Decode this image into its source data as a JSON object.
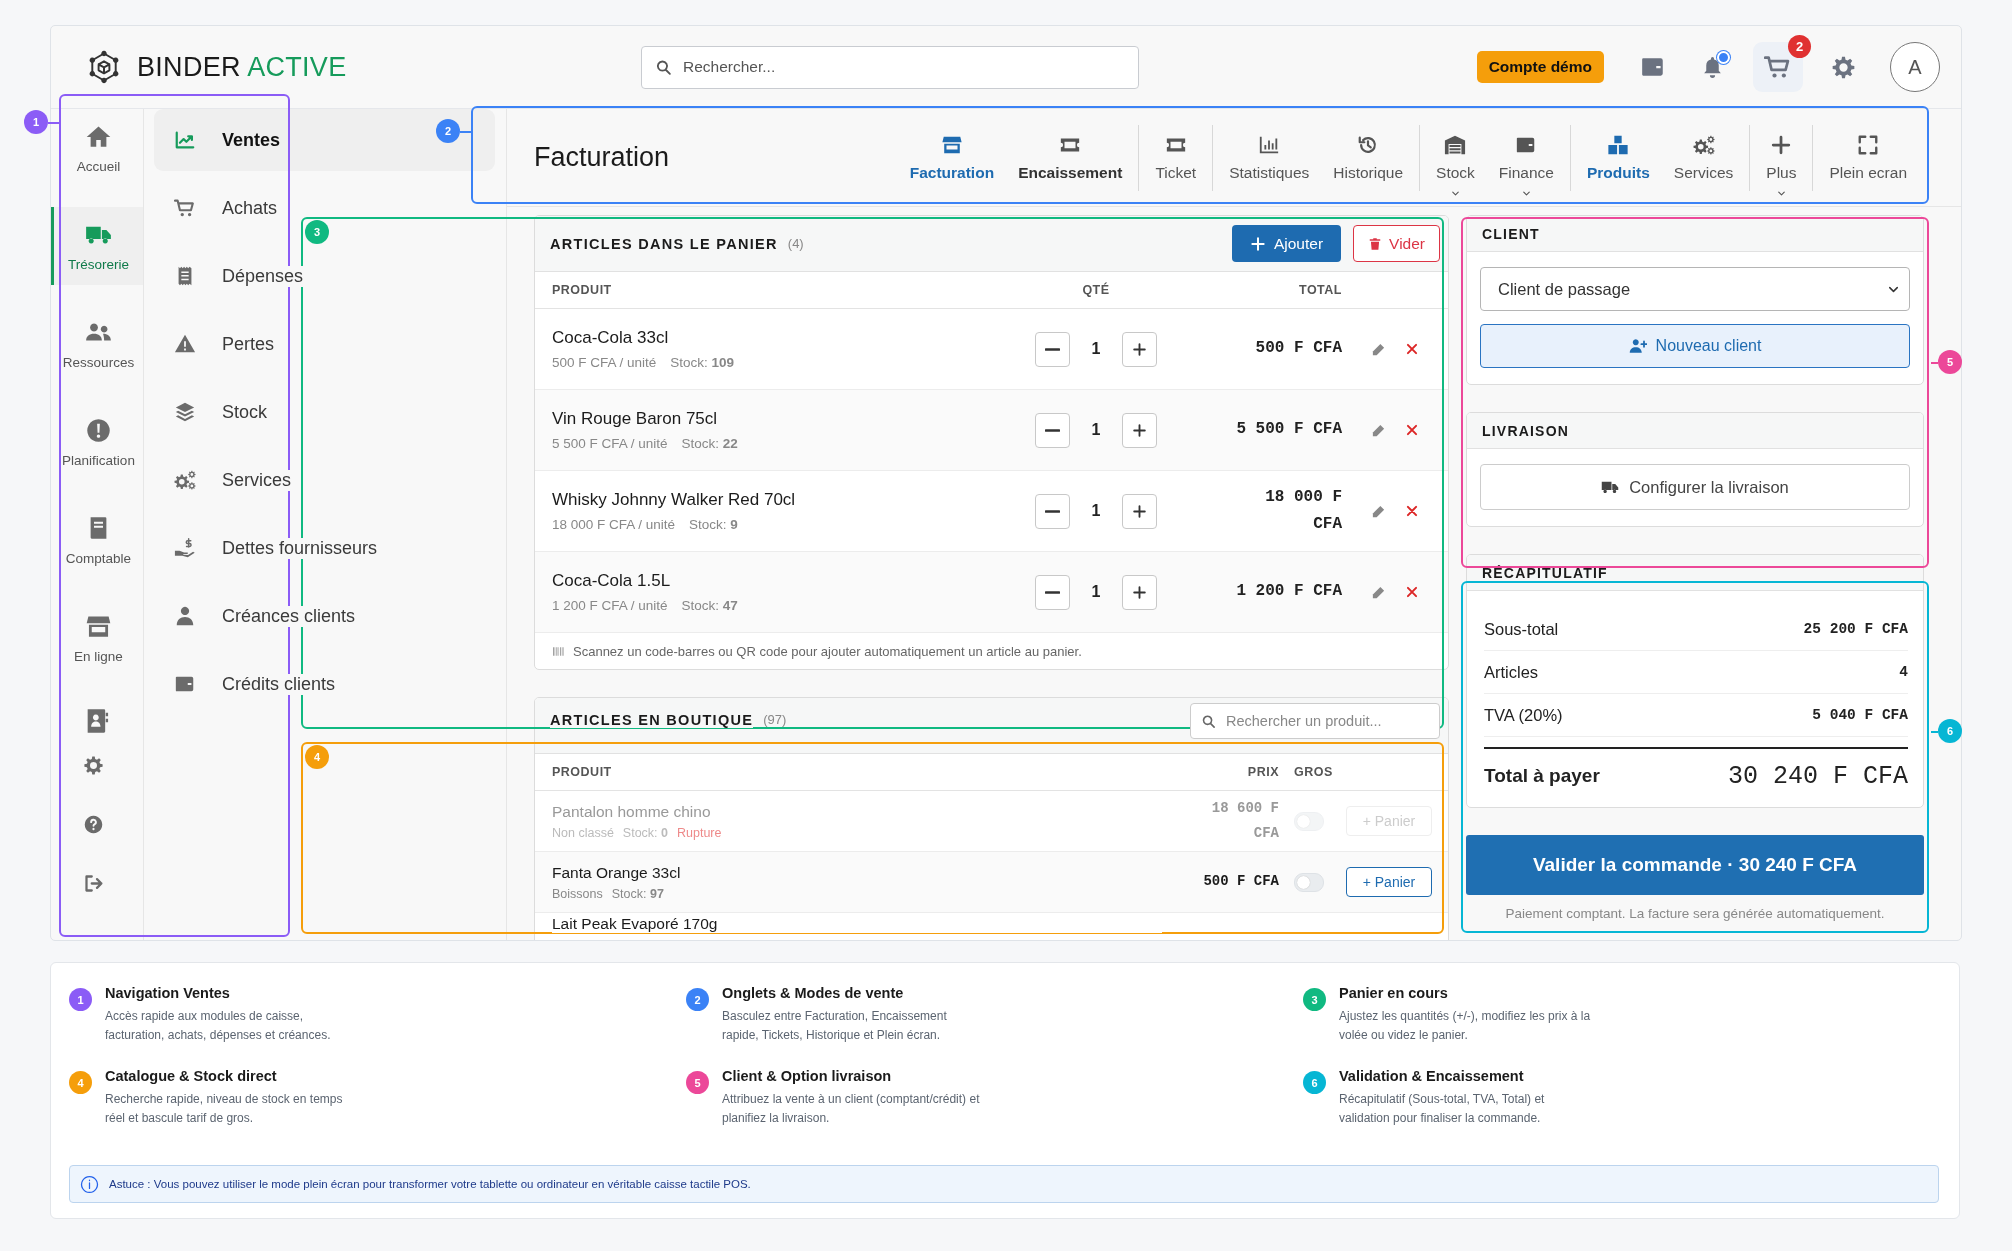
{
  "brand": {
    "name": "BINDER",
    "accent": "ACTIVE"
  },
  "search": {
    "placeholder": "Rechercher..."
  },
  "header": {
    "demo_badge": "Compte démo",
    "notifications_unread": true,
    "cart_count": "2",
    "avatar": "A"
  },
  "rail": [
    {
      "label": "Accueil",
      "selected": false
    },
    {
      "label": "Trésorerie",
      "selected": true
    },
    {
      "label": "Ressources",
      "selected": false
    },
    {
      "label": "Planification",
      "selected": false
    },
    {
      "label": "Comptable",
      "selected": false
    },
    {
      "label": "En ligne",
      "selected": false
    }
  ],
  "subnav": [
    {
      "label": "Ventes",
      "selected": true
    },
    {
      "label": "Achats",
      "selected": false
    },
    {
      "label": "Dépenses",
      "selected": false
    },
    {
      "label": "Pertes",
      "selected": false
    },
    {
      "label": "Stock",
      "selected": false
    },
    {
      "label": "Services",
      "selected": false
    },
    {
      "label": "Dettes fournisseurs",
      "selected": false
    },
    {
      "label": "Créances clients",
      "selected": false
    },
    {
      "label": "Crédits clients",
      "selected": false
    }
  ],
  "toolbar": {
    "title": "Facturation",
    "groups": [
      [
        {
          "label": "Facturation",
          "selected": true,
          "bold": false,
          "dropdown": false
        },
        {
          "label": "Encaissement",
          "selected": false,
          "bold": true,
          "dropdown": false
        }
      ],
      [
        {
          "label": "Ticket",
          "selected": false,
          "bold": false,
          "dropdown": false
        }
      ],
      [
        {
          "label": "Statistiques",
          "selected": false,
          "bold": false,
          "dropdown": false
        },
        {
          "label": "Historique",
          "selected": false,
          "bold": false,
          "dropdown": false
        }
      ],
      [
        {
          "label": "Stock",
          "selected": false,
          "bold": false,
          "dropdown": true
        },
        {
          "label": "Finance",
          "selected": false,
          "bold": false,
          "dropdown": true
        }
      ],
      [
        {
          "label": "Produits",
          "selected": true,
          "bold": false,
          "dropdown": false
        },
        {
          "label": "Services",
          "selected": false,
          "bold": false,
          "dropdown": false
        }
      ],
      [
        {
          "label": "Plus",
          "selected": false,
          "bold": false,
          "dropdown": true
        }
      ],
      [
        {
          "label": "Plein ecran",
          "selected": false,
          "bold": false,
          "dropdown": false
        }
      ]
    ]
  },
  "cart": {
    "title": "ARTICLES DANS LE PANIER",
    "count": "(4)",
    "add_button": "Ajouter",
    "clear_button": "Vider",
    "columns": [
      "PRODUIT",
      "QTÉ",
      "TOTAL"
    ],
    "rows": [
      {
        "name": "Coca-Cola 33cl",
        "unit_price": "500 F CFA / unité",
        "stock": "Stock: **109**",
        "quantity": "1",
        "total": "500 F CFA"
      },
      {
        "name": "Vin Rouge Baron 75cl",
        "unit_price": "5 500 F CFA / unité",
        "stock": "Stock: **22**",
        "quantity": "1",
        "total": "5 500 F CFA"
      },
      {
        "name": "Whisky Johnny Walker Red 70cl",
        "unit_price": "18 000 F CFA / unité",
        "stock": "Stock: **9**",
        "quantity": "1",
        "total": "18 000 F CFA"
      },
      {
        "name": "Coca-Cola 1.5L",
        "unit_price": "1 200 F CFA / unité",
        "stock": "Stock: **47**",
        "quantity": "1",
        "total": "1 200 F CFA"
      }
    ],
    "scan_hint": "Scannez un code-barres ou QR code pour ajouter automatiquement un article au panier."
  },
  "catalog": {
    "title": "ARTICLES EN BOUTIQUE",
    "count": "(97)",
    "search_placeholder": "Rechercher un produit...",
    "columns": [
      "PRODUIT",
      "PRIX",
      "GROS"
    ],
    "rows": [
      {
        "name": "Pantalon homme chino",
        "category": "Non classé",
        "stock": "Stock: **0**",
        "status": "Rupture",
        "price": "18 600 F CFA",
        "available": false,
        "wholesale": false,
        "button": "+ Panier"
      },
      {
        "name": "Fanta Orange 33cl",
        "category": "Boissons",
        "stock": "Stock: **97**",
        "price": "500 F CFA",
        "available": true,
        "wholesale": false,
        "button": "+ Panier"
      },
      {
        "name": "Lait Peak Evaporé 170g",
        "available": true
      }
    ]
  },
  "client": {
    "title": "CLIENT",
    "selected_client": "Client de passage",
    "new_button": "Nouveau client"
  },
  "delivery": {
    "title": "LIVRAISON",
    "button": "Configurer la livraison"
  },
  "summary": {
    "title": "RÉCAPITULATIF",
    "lines": [
      {
        "label": "Sous-total",
        "value": "25 200 F CFA"
      },
      {
        "label": "Articles",
        "value": "4"
      },
      {
        "label": "TVA (20%)",
        "value": "5 040 F CFA"
      }
    ],
    "total_label": "Total à payer",
    "total": "30 240 F CFA"
  },
  "checkout": {
    "button": "Valider la commande · 30 240 F CFA",
    "note": "Paiement comptant. La facture sera générée automatiquement."
  },
  "callouts": [
    {
      "number": "1",
      "color": "#8b5cf6"
    },
    {
      "number": "2",
      "color": "#3b82f6"
    },
    {
      "number": "3",
      "color": "#10b981"
    },
    {
      "number": "4",
      "color": "#f59e0b"
    },
    {
      "number": "5",
      "color": "#ec4899"
    },
    {
      "number": "6",
      "color": "#06b6d4"
    }
  ],
  "legend": [
    {
      "number": "1",
      "color": "#8b5cf6",
      "title": "Navigation Ventes",
      "text": "Accès rapide aux modules de caisse, facturation, achats, dépenses et créances."
    },
    {
      "number": "2",
      "color": "#3b82f6",
      "title": "Onglets & Modes de vente",
      "text": "Basculez entre Facturation, Encaissement rapide, Tickets, Historique et Plein écran."
    },
    {
      "number": "3",
      "color": "#10b981",
      "title": "Panier en cours",
      "text": "Ajustez les quantités (+/-), modifiez les prix à la volée ou videz le panier."
    },
    {
      "number": "4",
      "color": "#f59e0b",
      "title": "Catalogue & Stock direct",
      "text": "Recherche rapide, niveau de stock en temps réel et bascule tarif de gros."
    },
    {
      "number": "5",
      "color": "#ec4899",
      "title": "Client & Option livraison",
      "text": "Attribuez la vente à un client (comptant/crédit) et planifiez la livraison."
    },
    {
      "number": "6",
      "color": "#06b6d4",
      "title": "Validation & Encaissement",
      "text": "Récapitulatif (Sous-total, TVA, Total) et validation pour finaliser la commande."
    }
  ],
  "tip": "Astuce : Vous pouvez utiliser le mode plein écran pour transformer votre tablette ou ordinateur en véritable caisse tactile POS."
}
